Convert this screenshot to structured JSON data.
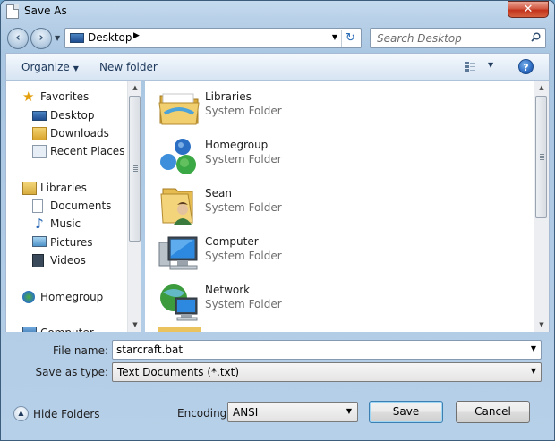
{
  "window": {
    "title": "Save As",
    "close_label": "✕"
  },
  "nav": {
    "back_label": "‹",
    "forward_label": "›",
    "history_label": "▼",
    "location": "Desktop",
    "breadcrumb_arrow": "▶",
    "address_dropdown": "▼",
    "refresh_label": "↻",
    "search_placeholder": "Search Desktop"
  },
  "commandbar": {
    "organize_label": "Organize",
    "organize_dd": "▼",
    "new_folder_label": "New folder",
    "views_dd": "▼",
    "help_label": "?"
  },
  "sidebar": {
    "items": [
      {
        "label": "Favorites",
        "icon": "star-icon"
      },
      {
        "label": "Desktop",
        "icon": "desktop-icon"
      },
      {
        "label": "Downloads",
        "icon": "downloads-icon"
      },
      {
        "label": "Recent Places",
        "icon": "recent-places-icon"
      },
      {
        "label": "Libraries",
        "icon": "libraries-icon"
      },
      {
        "label": "Documents",
        "icon": "documents-icon"
      },
      {
        "label": "Music",
        "icon": "music-icon"
      },
      {
        "label": "Pictures",
        "icon": "pictures-icon"
      },
      {
        "label": "Videos",
        "icon": "videos-icon"
      },
      {
        "label": "Homegroup",
        "icon": "homegroup-icon"
      },
      {
        "label": "Computer",
        "icon": "computer-icon"
      }
    ]
  },
  "files": [
    {
      "name": "Libraries",
      "type": "System Folder",
      "icon": "libraries-folder-icon"
    },
    {
      "name": "Homegroup",
      "type": "System Folder",
      "icon": "homegroup-icon"
    },
    {
      "name": "Sean",
      "type": "System Folder",
      "icon": "user-folder-icon"
    },
    {
      "name": "Computer",
      "type": "System Folder",
      "icon": "computer-icon"
    },
    {
      "name": "Network",
      "type": "System Folder",
      "icon": "network-icon"
    }
  ],
  "scroll": {
    "up": "▲",
    "down": "▼"
  },
  "form": {
    "filename_label": "File name:",
    "filename_value": "starcraft.bat",
    "filename_dd": "▼",
    "savetype_label": "Save as type:",
    "savetype_value": "Text Documents (*.txt)",
    "savetype_dd": "▼",
    "hide_folders_label": "Hide Folders",
    "hide_folders_icon": "▲",
    "encoding_label": "Encoding:",
    "encoding_value": "ANSI",
    "encoding_dd": "▼",
    "save_label": "Save",
    "cancel_label": "Cancel"
  },
  "colors": {
    "accent": "#1e395b",
    "close": "#c2331b"
  }
}
